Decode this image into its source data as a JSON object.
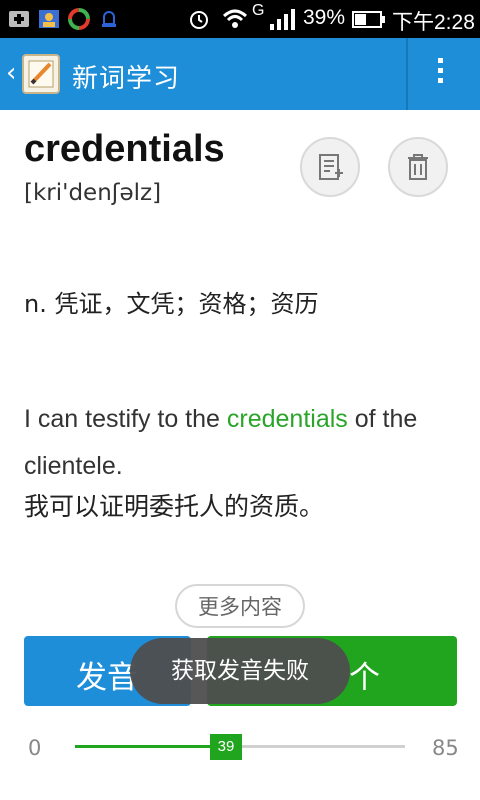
{
  "status_bar": {
    "battery": "39%",
    "time": "下午2:28",
    "network": "G"
  },
  "app_bar": {
    "title": "新词学习",
    "back_icon": "chevron-left-icon",
    "app_icon": "word-notebook-icon",
    "menu_icon": "overflow-menu-icon",
    "color": "#1e8ed9"
  },
  "word": {
    "text": "credentials",
    "phonetic": "[kri'denʃəlz]",
    "definition": "n. 凭证，文凭；资格；资历",
    "example_before": "I can testify to the ",
    "example_highlight": "credentials",
    "example_after": " of the clientele.",
    "example_translation": "我可以证明委托人的资质。"
  },
  "actions": {
    "add_to_notebook_icon": "add-note-icon",
    "delete_icon": "trash-icon",
    "more_label": "更多内容",
    "left_button_label": "发音",
    "right_button_label": "个",
    "left_color": "#1e8ed9",
    "right_color": "#21a41e"
  },
  "toast": {
    "message": "获取发音失败"
  },
  "progress": {
    "min_label": "0",
    "max_label": "85",
    "current_label": "39",
    "current": 39,
    "max": 85
  }
}
